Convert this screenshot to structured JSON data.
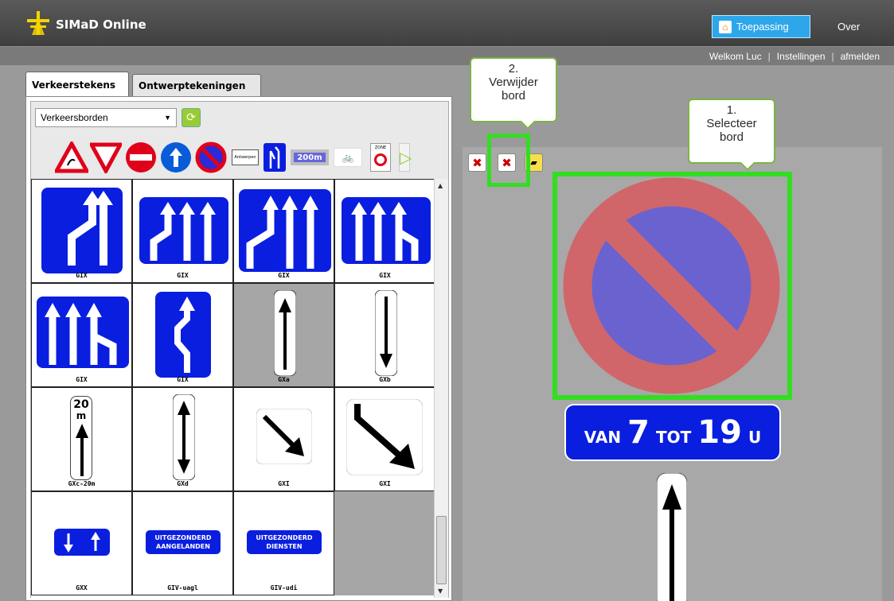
{
  "header": {
    "app_title": "SIMaD Online",
    "nav": {
      "toepassing": "Toepassing",
      "over": "Over"
    }
  },
  "userbar": {
    "welcome": "Welkom Luc",
    "separator": "|",
    "settings": "Instellingen",
    "logout": "afmelden"
  },
  "tabs": [
    "Verkeerstekens",
    "Ontwerptekeningen"
  ],
  "category_select": {
    "value": "Verkeersborden"
  },
  "palette_labels": {
    "antwerpen": "Antwerpen",
    "distance": "200m",
    "zone": "ZONE"
  },
  "signs": [
    {
      "caption": "GIX"
    },
    {
      "caption": "GIX"
    },
    {
      "caption": "GIX"
    },
    {
      "caption": "GIX"
    },
    {
      "caption": "GIX"
    },
    {
      "caption": "GIX"
    },
    {
      "caption": "GXa"
    },
    {
      "caption": "GXb"
    },
    {
      "caption": "GXc-20m"
    },
    {
      "caption": "GXd"
    },
    {
      "caption": "GXI"
    },
    {
      "caption": "GXI"
    },
    {
      "caption": "GXX"
    },
    {
      "caption": "GIV-uagl"
    },
    {
      "caption": "GIV-udi"
    }
  ],
  "sign_texts": {
    "gxc_top": "20",
    "gxc_unit": "m",
    "uagl_line1": "UITGEZONDERD",
    "uagl_line2": "AANGELANDEN",
    "udi_line1": "UITGEZONDERD",
    "udi_line2": "DIENSTEN"
  },
  "canvas": {
    "subplate": {
      "van": "VAN",
      "from": "7",
      "tot": "TOT",
      "to": "19",
      "unit": "U"
    }
  },
  "callouts": {
    "delete": {
      "line1": "2.",
      "line2": "Verwijder",
      "line3": "bord"
    },
    "select": {
      "line1": "1.",
      "line2": "Selecteer",
      "line3": "bord"
    }
  },
  "colors": {
    "highlight": "#33dd22",
    "sign_blue": "#0a1ee0",
    "prohibition_red": "#d0666a",
    "prohibition_blue": "#6a63cf"
  }
}
